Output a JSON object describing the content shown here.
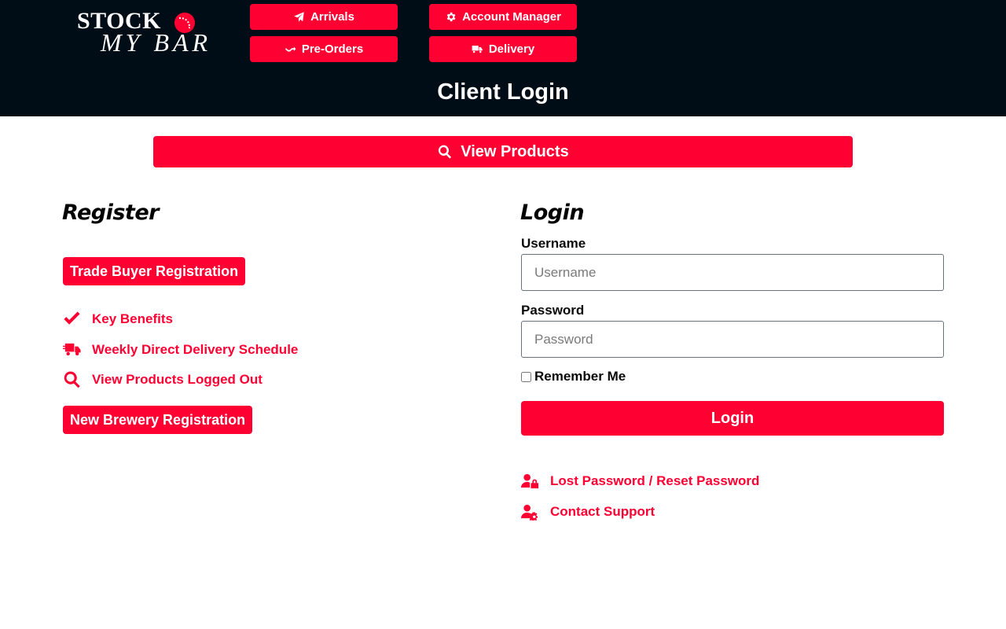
{
  "brand": {
    "logo_line1": "STOCK",
    "logo_line2": "MY BAR",
    "accent_color": "#ff0033",
    "header_bg": "#000d16"
  },
  "nav": {
    "arrivals": {
      "label": "Arrivals",
      "icon": "paper-plane-icon"
    },
    "pre_orders": {
      "label": "Pre-Orders",
      "icon": "route-arrow-icon"
    },
    "account_manager": {
      "label": "Account Manager",
      "icon": "gear-icon"
    },
    "delivery": {
      "label": "Delivery",
      "icon": "truck-icon"
    }
  },
  "header": {
    "title": "Client Login"
  },
  "view_products": {
    "label": "View Products",
    "icon": "search-icon"
  },
  "register": {
    "heading": "Register",
    "trade_button": "Trade Buyer Registration",
    "links": [
      {
        "label": "Key Benefits",
        "icon": "check-icon"
      },
      {
        "label": "Weekly Direct Delivery Schedule",
        "icon": "truck-icon"
      },
      {
        "label": "View Products Logged Out",
        "icon": "search-icon"
      }
    ],
    "brewery_button": "New Brewery Registration"
  },
  "login": {
    "heading": "Login",
    "username_label": "Username",
    "username_placeholder": "Username",
    "username_value": "",
    "password_label": "Password",
    "password_placeholder": "Password",
    "password_value": "",
    "remember_label": "Remember Me",
    "remember_checked": false,
    "submit_label": "Login",
    "links": [
      {
        "label": "Lost Password / Reset Password",
        "icon": "user-lock-icon"
      },
      {
        "label": "Contact Support",
        "icon": "user-cog-icon"
      }
    ]
  }
}
